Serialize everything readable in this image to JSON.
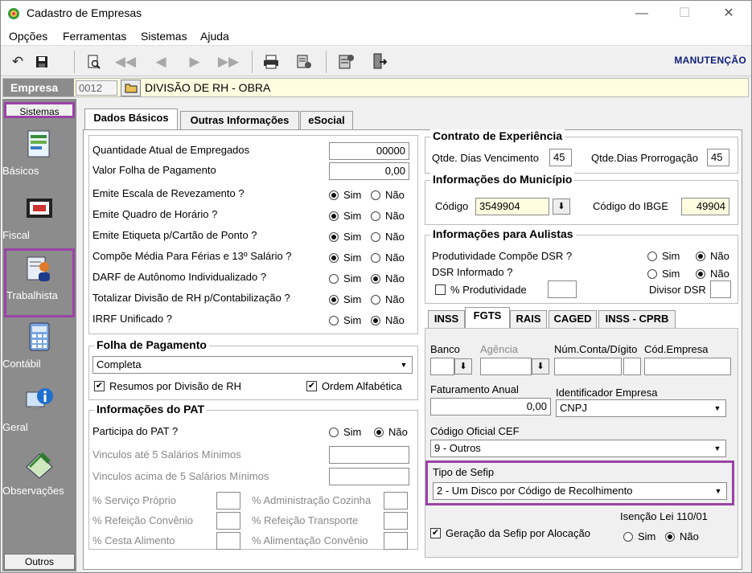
{
  "window": {
    "title": "Cadastro de Empresas"
  },
  "menu": [
    "Opções",
    "Ferramentas",
    "Sistemas",
    "Ajuda"
  ],
  "toolbar": {
    "mode": "MANUTENÇÃO"
  },
  "empresa": {
    "label": "Empresa",
    "code": "0012",
    "name": "DIVISÃO DE RH - OBRA"
  },
  "sidebar": {
    "top_button": "Sistemas",
    "bottom_button": "Outros",
    "items": [
      "Básicos",
      "Fiscal",
      "Trabalhista",
      "Contábil",
      "Geral",
      "Observações"
    ]
  },
  "tabs": [
    "Dados Básicos",
    "Outras Informações",
    "eSocial"
  ],
  "basic": {
    "qtd_label": "Quantidade Atual de Empregados",
    "qtd_value": "00000",
    "folha_label": "Valor Folha de Pagamento",
    "folha_value": "0,00",
    "sim": "Sim",
    "nao": "Não",
    "questions": [
      "Emite Escala de Revezamento ?",
      "Emite Quadro de Horário ?",
      "Emite Etiqueta p/Cartão de Ponto ?",
      "Compõe Média Para Férias e 13º Salário ?",
      "DARF de Autônomo Individualizado ?",
      "Totalizar Divisão de RH p/Contabilização ?",
      "IRRF Unificado ?"
    ]
  },
  "folha": {
    "title": "Folha de Pagamento",
    "selected": "Completa",
    "resumos": "Resumos por Divisão de RH",
    "ordem": "Ordem Alfabética"
  },
  "pat": {
    "title": "Informações do PAT",
    "participa": "Participa do PAT ?",
    "vinc5": "Vinculos até 5 Salários Mínimos",
    "vincmais": "Vinculos acima de 5 Salários Mínimos",
    "servico": "% Serviço Próprio",
    "admcozinha": "% Administração Cozinha",
    "refconv": "% Refeição Convênio",
    "reftransp": "% Refeição Transporte",
    "cesta": "% Cesta Alimento",
    "aliconv": "% Alimentação Convênio"
  },
  "contrato": {
    "title": "Contrato de Experiência",
    "venc_label": "Qtde. Dias Vencimento",
    "venc_value": "45",
    "prorr_label": "Qtde.Dias Prorrogação",
    "prorr_value": "45"
  },
  "municipio": {
    "title": "Informações do Município",
    "codigo_label": "Código",
    "codigo_value": "3549904",
    "ibge_label": "Código do IBGE",
    "ibge_value": "49904"
  },
  "aulistas": {
    "title": "Informações para Aulistas",
    "prod": "Produtividade Compõe DSR ?",
    "dsr": "DSR Informado ?",
    "perc": "% Produtividade",
    "divisor": "Divisor DSR"
  },
  "inner_tabs": [
    "INSS",
    "FGTS",
    "RAIS",
    "CAGED",
    "INSS - CPRB"
  ],
  "fgts": {
    "banco": "Banco",
    "agencia": "Agência",
    "conta": "Núm.Conta/Dígito",
    "cod_empresa": "Cód.Empresa",
    "fat_label": "Faturamento Anual",
    "fat_value": "0,00",
    "ident_label": "Identificador Empresa",
    "ident_value": "CNPJ",
    "cef_label": "Código Oficial CEF",
    "cef_value": "9 - Outros",
    "sefip_label": "Tipo de Sefip",
    "sefip_value": "2 - Um Disco por Código de Recolhimento",
    "isencao": "Isenção Lei 110/01",
    "geracao": "Geração da Sefip por Alocação"
  }
}
